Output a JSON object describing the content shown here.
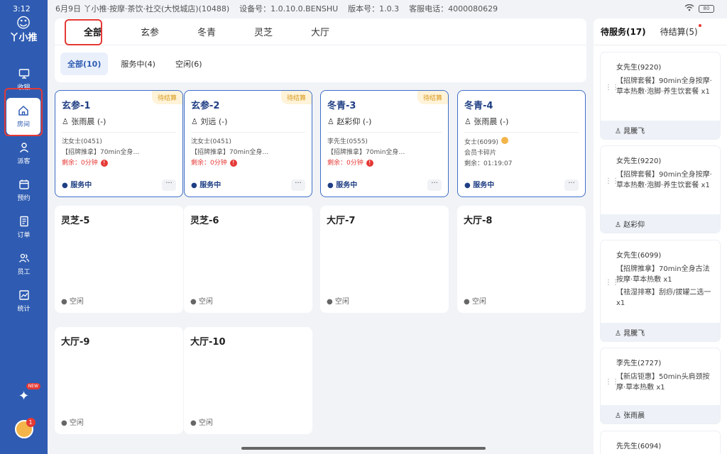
{
  "statusbar": {
    "time": "3:12",
    "date_shop": "6月9日 丫小推·按摩·茶饮·社交(大悦城店)(10488)",
    "device": "设备号：1.0.10.0.BENSHU",
    "version": "版本号：1.0.3",
    "hotline": "客服电话：4000080629",
    "battery": "80"
  },
  "sidebar": {
    "logo": "丫小推",
    "items": [
      {
        "label": "收银",
        "icon": "monitor-icon"
      },
      {
        "label": "房间",
        "icon": "home-icon"
      },
      {
        "label": "派客",
        "icon": "user-icon"
      },
      {
        "label": "预约",
        "icon": "calendar-icon"
      },
      {
        "label": "订单",
        "icon": "document-icon"
      },
      {
        "label": "员工",
        "icon": "people-icon"
      },
      {
        "label": "统计",
        "icon": "chart-icon"
      }
    ],
    "new_badge": "NEW",
    "avatar_badge": "1"
  },
  "area_tabs": [
    "全部",
    "玄参",
    "冬青",
    "灵芝",
    "大厅"
  ],
  "filters": [
    "全部(10)",
    "服务中(4)",
    "空闲(6)"
  ],
  "rooms": [
    {
      "name": "玄参-1",
      "tag": "待结算",
      "staff": "张雨晨 (-)",
      "customer": "沈女士(0451)",
      "service": "【招牌推拿】70min全身…",
      "remain": "剩余：0分钟",
      "status": "服务中"
    },
    {
      "name": "玄参-2",
      "tag": "待结算",
      "staff": "刘远 (-)",
      "customer": "沈女士(0451)",
      "service": "【招牌推拿】70min全身…",
      "remain": "剩余：0分钟",
      "status": "服务中"
    },
    {
      "name": "冬青-3",
      "tag": "待结算",
      "staff": "赵彩仰 (-)",
      "customer": "李先生(0555)",
      "service": "【招牌推拿】70min全身…",
      "remain": "剩余：0分钟",
      "status": "服务中"
    },
    {
      "name": "冬青-4",
      "tag": "",
      "staff": "张雨晨 (-)",
      "customer": "女士(6099)",
      "service": "会员卡碎片",
      "remain": "剩余：01:19:07",
      "status": "服务中"
    },
    {
      "name": "灵芝-5",
      "status": "空闲"
    },
    {
      "name": "灵芝-6",
      "status": "空闲"
    },
    {
      "name": "大厅-7",
      "status": "空闲"
    },
    {
      "name": "大厅-8",
      "status": "空闲"
    },
    {
      "name": "大厅-9",
      "status": "空闲"
    },
    {
      "name": "大厅-10",
      "status": "空闲"
    }
  ],
  "right_panel": {
    "tabs": [
      "待服务(17)",
      "待结算(5)"
    ],
    "orders": [
      {
        "customer": "女先生(9220)",
        "services": [
          "【招牌套餐】90min全身按摩·草本热敷·泡脚·养生饮套餐 x1"
        ],
        "tech": "晁騰飞"
      },
      {
        "customer": "女先生(9220)",
        "services": [
          "【招牌套餐】90min全身按摩·草本热敷·泡脚·养生饮套餐 x1"
        ],
        "tech": "赵彩仰"
      },
      {
        "customer": "女先生(6099)",
        "services": [
          "【招牌推拿】70min全身古法按摩·草本热敷 x1",
          "【祛湿排寒】刮痧/拔罐二选一 x1"
        ],
        "tech": "晁騰飞"
      },
      {
        "customer": "李先生(2727)",
        "services": [
          "【新店钜惠】50min头肩颈按摩·草本热敷 x1"
        ],
        "tech": "张雨晨"
      },
      {
        "customer": "先先生(6094)",
        "services": [],
        "tech": ""
      }
    ]
  }
}
